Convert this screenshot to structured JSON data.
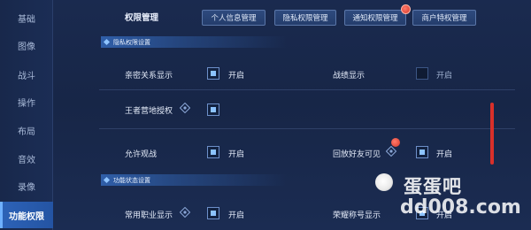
{
  "sidebar": {
    "items": [
      {
        "label": "基础"
      },
      {
        "label": "图像"
      },
      {
        "label": "战斗"
      },
      {
        "label": "操作"
      },
      {
        "label": "布局"
      },
      {
        "label": "音效"
      },
      {
        "label": "录像"
      },
      {
        "label": "功能权限",
        "active": true
      }
    ]
  },
  "header": {
    "title": "权限管理",
    "tabs": [
      {
        "label": "个人信息管理"
      },
      {
        "label": "隐私权限管理"
      },
      {
        "label": "通知权限管理"
      },
      {
        "label": "商户特权管理"
      }
    ]
  },
  "sections": {
    "privacy": "隐私权限设置",
    "function": "功能状态设置"
  },
  "settings": {
    "intimacy": {
      "label": "亲密关系显示",
      "state": "开启"
    },
    "battle_record": {
      "label": "战绩显示",
      "state": "开启"
    },
    "camp_auth": {
      "label": "王者营地授权"
    },
    "spectate": {
      "label": "允许观战",
      "state": "开启"
    },
    "replay_friends": {
      "label": "回放好友可见",
      "state": "开启"
    },
    "job_display": {
      "label": "常用职业显示",
      "state": "开启"
    },
    "honor_title": {
      "label": "荣耀称号显示",
      "state": "开启"
    }
  },
  "watermark": {
    "brand": "蛋蛋吧",
    "url": "dd008.com"
  },
  "colors": {
    "accent": "#2d63b8",
    "highlight_arrow": "#d9302a"
  }
}
